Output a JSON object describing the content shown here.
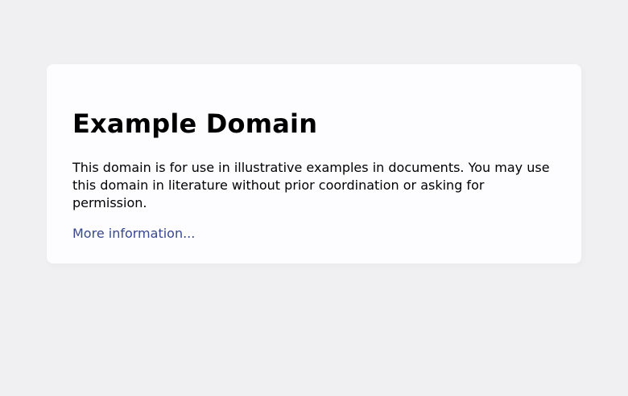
{
  "page": {
    "title": "Example Domain",
    "description": "This domain is for use in illustrative examples in documents. You may use this domain in literature without prior coordination or asking for permission.",
    "more_link_label": "More information..."
  },
  "colors": {
    "background": "#f0f0f2",
    "card": "#fdfdff",
    "link": "#38488f",
    "text": "#000000"
  }
}
